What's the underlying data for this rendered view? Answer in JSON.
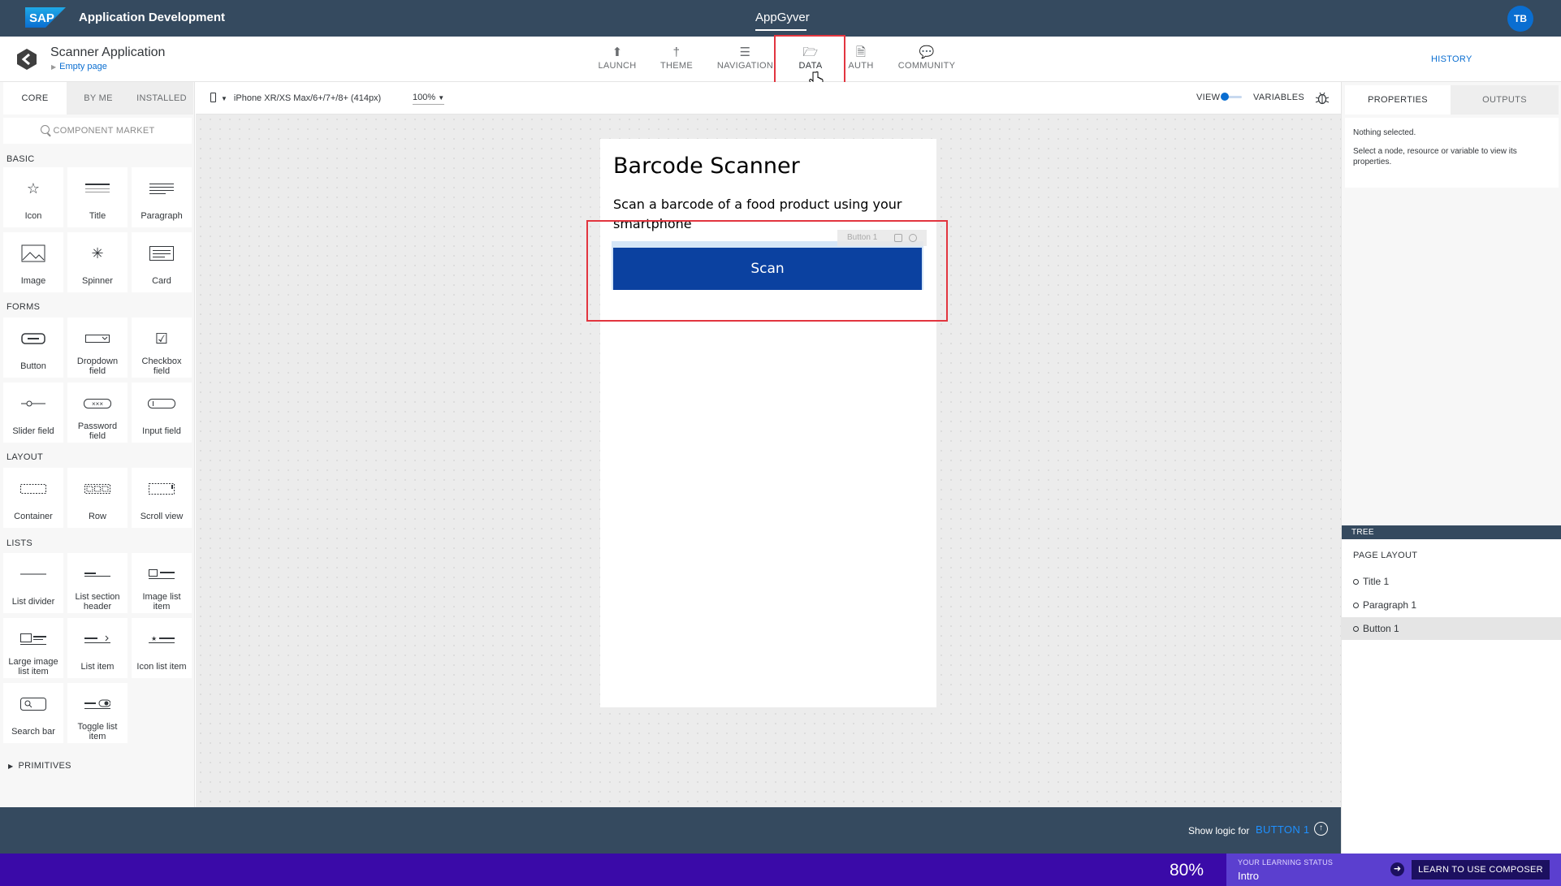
{
  "shell": {
    "brand": "SAP",
    "title": "Application Development",
    "center_title": "AppGyver",
    "avatar_initials": "TB"
  },
  "header": {
    "app_name": "Scanner Application",
    "page_name": "Empty page",
    "nav_tabs": [
      {
        "label": "LAUNCH",
        "icon": "upload-circle-icon"
      },
      {
        "label": "THEME",
        "icon": "brush-icon"
      },
      {
        "label": "NAVIGATION",
        "icon": "list-icon"
      },
      {
        "label": "DATA",
        "icon": "folder-icon",
        "active": true
      },
      {
        "label": "AUTH",
        "icon": "document-code-icon"
      },
      {
        "label": "COMMUNITY",
        "icon": "chat-icon"
      }
    ],
    "history": "HISTORY"
  },
  "left_panel": {
    "tabs": [
      "CORE",
      "BY ME",
      "INSTALLED"
    ],
    "active_tab": "CORE",
    "search_placeholder": "COMPONENT MARKET",
    "sections": {
      "basic": "BASIC",
      "forms": "FORMS",
      "layout": "LAYOUT",
      "lists": "LISTS"
    },
    "basic": [
      "Icon",
      "Title",
      "Paragraph",
      "Image",
      "Spinner",
      "Card"
    ],
    "forms": [
      "Button",
      "Dropdown field",
      "Checkbox field",
      "Slider field",
      "Password field",
      "Input field"
    ],
    "layout": [
      "Container",
      "Row",
      "Scroll view"
    ],
    "lists": [
      "List divider",
      "List section header",
      "Image list item",
      "Large image list item",
      "List item",
      "Icon list item",
      "Search bar",
      "Toggle list item"
    ],
    "primitives": "PRIMITIVES"
  },
  "canvas_toolbar": {
    "device": "iPhone XR/XS Max/6+/7+/8+ (414px)",
    "zoom": "100%",
    "view_label": "VIEW",
    "variables_label": "VARIABLES"
  },
  "phone": {
    "title": "Barcode Scanner",
    "paragraph": "Scan a barcode of a food product using your smartphone",
    "button_label": "Scan",
    "selection_label": "Button 1"
  },
  "right_panel": {
    "tabs": [
      "PROPERTIES",
      "OUTPUTS"
    ],
    "active_tab": "PROPERTIES",
    "nothing_selected": "Nothing selected.",
    "hint": "Select a node, resource or variable to view its properties.",
    "tree_header": "TREE",
    "tree_root": "PAGE LAYOUT",
    "tree_items": [
      "Title 1",
      "Paragraph 1",
      "Button 1"
    ],
    "selected_item": "Button 1"
  },
  "logic_bar": {
    "label": "Show logic for",
    "target": "BUTTON 1"
  },
  "learning": {
    "percent": "80%",
    "label": "YOUR LEARNING STATUS",
    "status": "Intro",
    "button": "LEARN TO USE COMPOSER"
  },
  "colors": {
    "shell": "#354a5f",
    "accent": "#0a6ed1",
    "scan_button": "#0b41a0",
    "highlight": "#e2353f",
    "learn_bar": "#3a0aa8"
  }
}
